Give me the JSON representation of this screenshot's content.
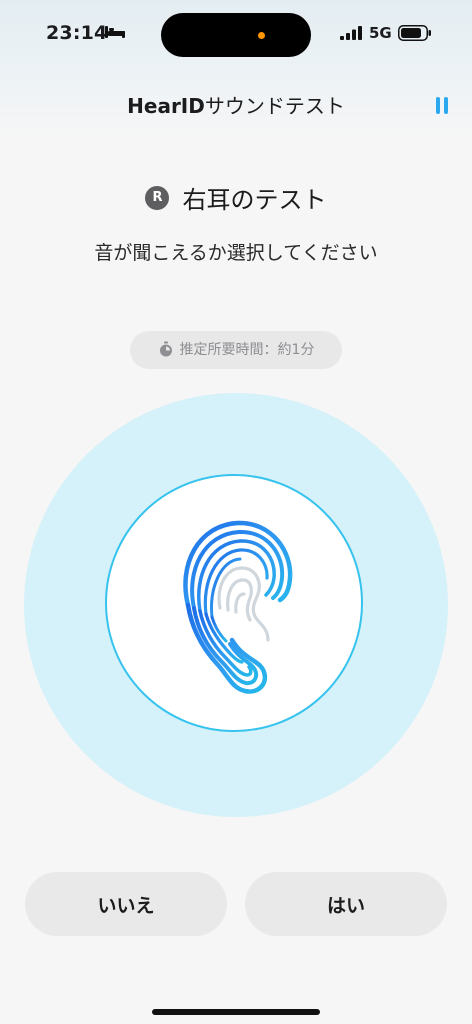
{
  "status_bar": {
    "time": "23:14",
    "network": "5G",
    "icons": [
      "bed-icon",
      "signal-icon",
      "battery-icon"
    ]
  },
  "header": {
    "brand": "HearID",
    "title_rest": "サウンドテスト",
    "pause_icon": "pause-icon"
  },
  "test": {
    "side_badge": "R",
    "title": "右耳のテスト",
    "instruction": "音が聞こえるか選択してください"
  },
  "duration": {
    "label": "推定所要時間：約1分",
    "icon": "timer-icon"
  },
  "illustration": {
    "icon": "ear-fingerprint-icon"
  },
  "buttons": {
    "no": "いいえ",
    "yes": "はい"
  },
  "colors": {
    "accent": "#2aa8f0",
    "ring": "#36c3ee",
    "halo": "#d5f1f9"
  }
}
